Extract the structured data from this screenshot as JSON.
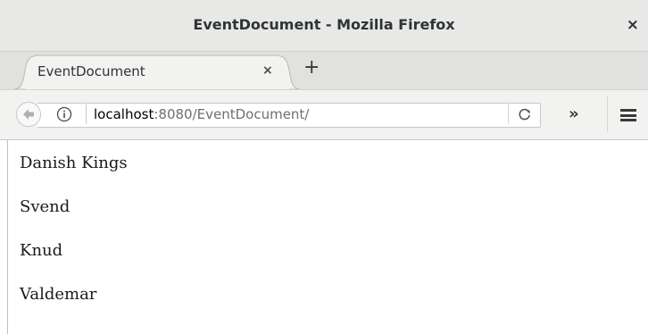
{
  "window": {
    "title": "EventDocument - Mozilla Firefox",
    "close_label": "×"
  },
  "tabs": [
    {
      "label": "EventDocument",
      "close_label": "×"
    }
  ],
  "new_tab_label": "+",
  "navbar": {
    "url_host": "localhost",
    "url_rest": ":8080/EventDocument/",
    "reload_icon": "reload-icon",
    "overflow_label": "»"
  },
  "content": {
    "heading": "Danish Kings",
    "items": [
      "Svend",
      "Knud",
      "Valdemar"
    ]
  }
}
